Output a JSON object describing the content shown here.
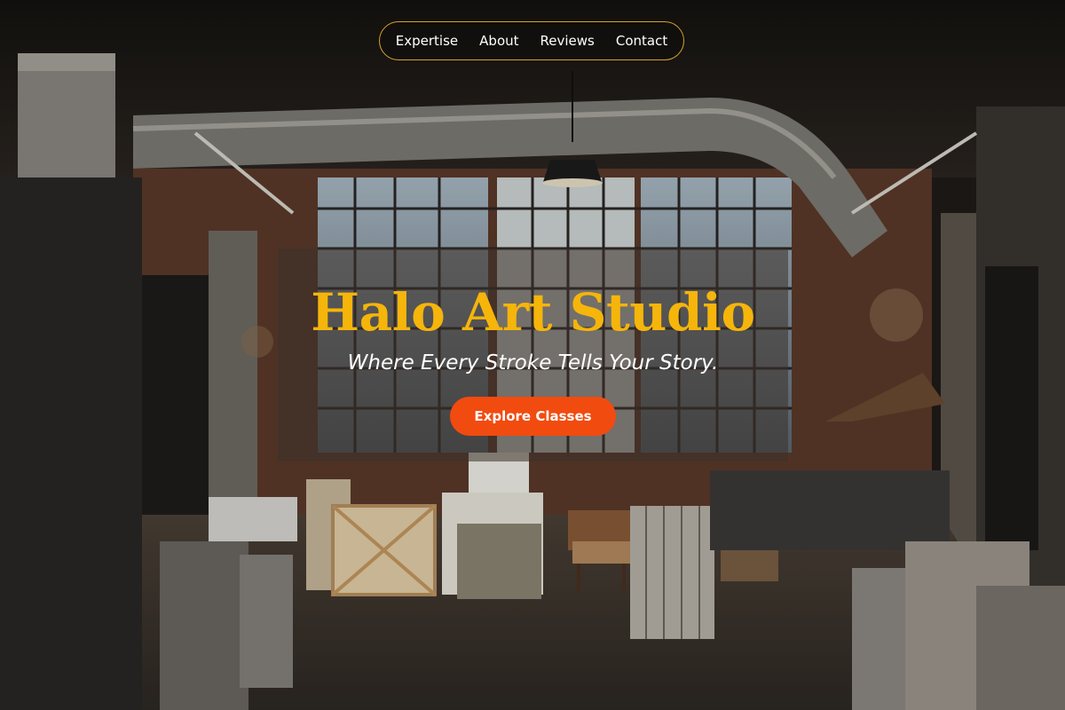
{
  "nav": {
    "items": [
      {
        "label": "Expertise"
      },
      {
        "label": "About"
      },
      {
        "label": "Reviews"
      },
      {
        "label": "Contact"
      }
    ]
  },
  "hero": {
    "title": "Halo Art Studio",
    "tagline": "Where Every Stroke Tells Your Story.",
    "cta_label": "Explore Classes"
  },
  "colors": {
    "accent": "#f5b50a",
    "cta": "#f24b0f",
    "nav_border": "#d8a22a"
  }
}
